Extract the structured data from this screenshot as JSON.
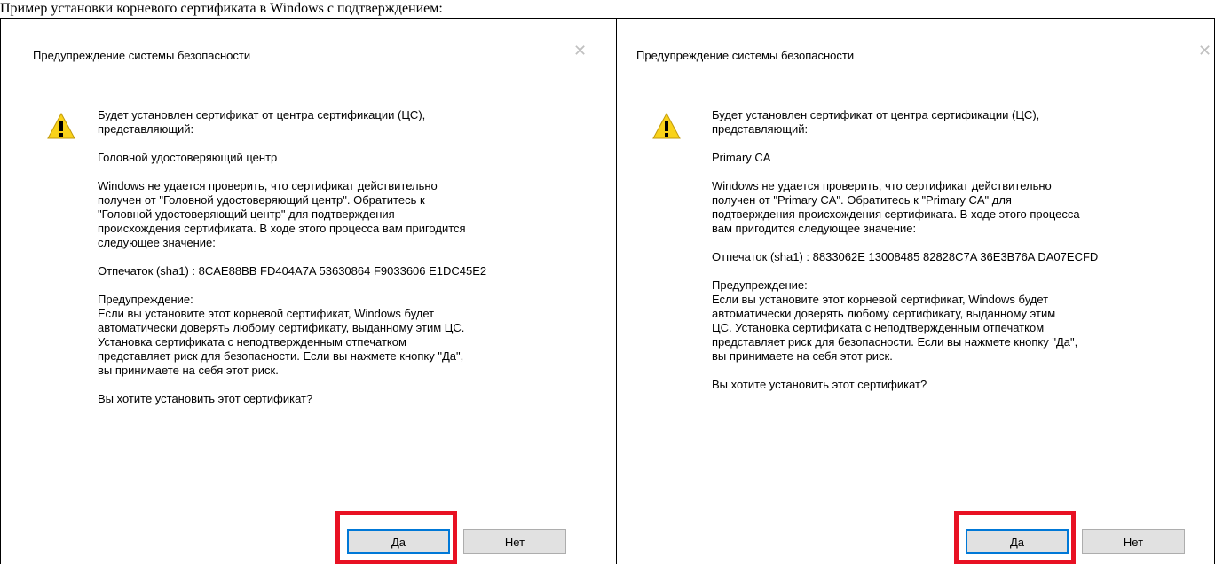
{
  "top_text": "Пример установки корневого сертификата в Windows с подтверждением:",
  "dialogs": [
    {
      "title": "Предупреждение системы безопасности",
      "intro": "Будет установлен сертификат от центра сертификации (ЦС),\nпредставляющий:",
      "ca_name": "Головной удостоверяющий центр",
      "verify_text": "Windows не удается проверить, что сертификат действительно\nполучен от \"Головной удостоверяющий центр\". Обратитесь к\n\"Головной удостоверяющий центр\" для подтверждения\nпроисхождения сертификата. В ходе этого процесса вам пригодится\nследующее значение:",
      "thumbprint": "Отпечаток (sha1) : 8CAE88BB FD404A7A 53630864 F9033606 E1DC45E2",
      "warning_text": "Предупреждение:\nЕсли вы установите этот корневой сертификат, Windows будет\nавтоматически доверять любому сертификату, выданному этим ЦС.\nУстановка сертификата с неподтвержденным отпечатком\nпредставляет риск для безопасности. Если вы нажмете кнопку \"Да\",\nвы принимаете на себя этот риск.",
      "question": "Вы хотите установить этот сертификат?",
      "yes_label": "Да",
      "no_label": "Нет"
    },
    {
      "title": "Предупреждение системы безопасности",
      "intro": "Будет установлен сертификат от центра сертификации (ЦС),\nпредставляющий:",
      "ca_name": "Primary CA",
      "verify_text": "Windows не удается проверить, что сертификат действительно\nполучен от \"Primary CA\". Обратитесь к \"Primary CA\" для\nподтверждения происхождения сертификата. В ходе этого процесса\nвам пригодится следующее значение:",
      "thumbprint": "Отпечаток (sha1) : 8833062E 13008485 82828C7A 36E3B76A DA07ECFD",
      "warning_text": "Предупреждение:\nЕсли вы установите этот корневой сертификат, Windows будет\nавтоматически доверять любому сертификату, выданному этим\nЦС. Установка сертификата с неподтвержденным отпечатком\nпредставляет риск для безопасности. Если вы нажмете кнопку \"Да\",\nвы принимаете на себя этот риск.",
      "question": "Вы хотите установить этот сертификат?",
      "yes_label": "Да",
      "no_label": "Нет"
    }
  ],
  "colors": {
    "highlight": "#e81123",
    "button_bg": "#e1e1e1",
    "default_border": "#0078d7",
    "warning_fill": "#f9d21a"
  }
}
